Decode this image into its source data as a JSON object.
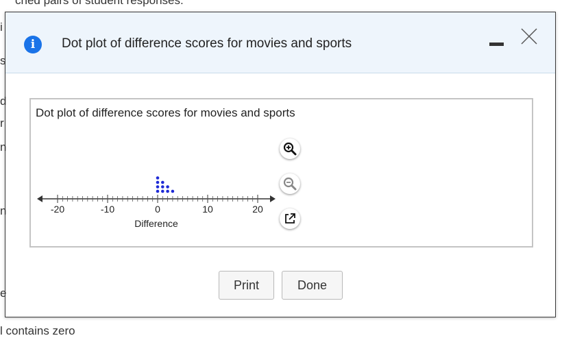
{
  "background": {
    "top_text": "ched pairs of student responses.",
    "bottom_text": "l contains zero",
    "left_fragments": [
      "i",
      "s",
      "d",
      "r",
      "n",
      "n",
      "e"
    ]
  },
  "dialog": {
    "title": "Dot plot of difference scores for movies and sports",
    "minimize_label": "minimize",
    "close_label": "close"
  },
  "figure": {
    "title": "Dot plot of difference scores for movies and sports",
    "tools": [
      "zoom-in",
      "zoom-out",
      "pop-out"
    ]
  },
  "chart_data": {
    "type": "scatter",
    "title": "Dot plot of difference scores for movies and sports",
    "xlabel": "Difference",
    "ylabel": "",
    "xlim": [
      -20,
      20
    ],
    "xticks": [
      -20,
      -10,
      0,
      10,
      20
    ],
    "tick_labels": [
      "-20",
      "-10",
      "0",
      "10",
      "20"
    ],
    "values": [
      0,
      0,
      0,
      0,
      1,
      1,
      1,
      2,
      2,
      3
    ],
    "dot_color": "#1f2bd6",
    "grid": false
  },
  "buttons": {
    "print": "Print",
    "done": "Done"
  },
  "colors": {
    "header_bg": "#eef5fc",
    "info_icon": "#1a73e8"
  }
}
